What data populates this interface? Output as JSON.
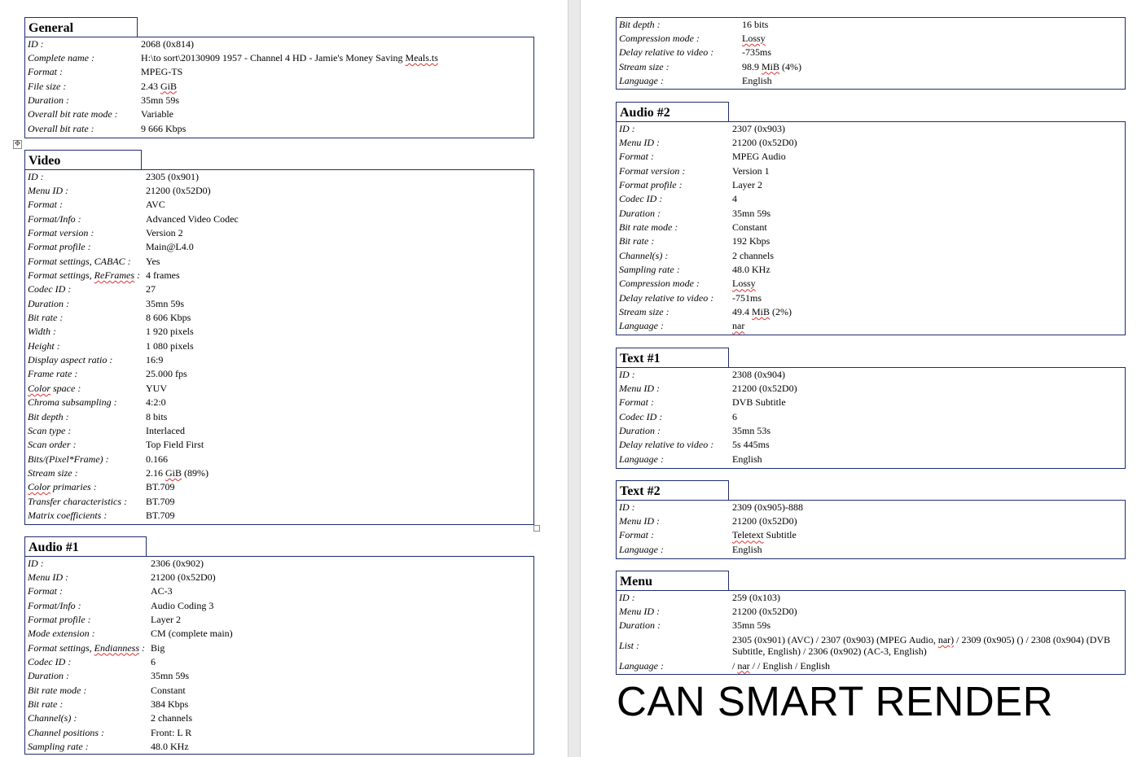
{
  "left_page": {
    "general": {
      "title": "General",
      "rows": [
        {
          "k": "ID :",
          "v": "2068 (0x814)"
        },
        {
          "k": "Complete name :",
          "v": "H:\\to sort\\20130909 1957 - Channel 4 HD - Jamie's Money Saving Meals.ts"
        },
        {
          "k": "Format :",
          "v": "MPEG-TS"
        },
        {
          "k": "File size :",
          "v": "2.43 GiB"
        },
        {
          "k": "Duration :",
          "v": "35mn 59s"
        },
        {
          "k": "Overall bit rate mode :",
          "v": "Variable"
        },
        {
          "k": "Overall bit rate :",
          "v": "9 666 Kbps"
        }
      ]
    },
    "video": {
      "title": "Video",
      "rows": [
        {
          "k": "ID :",
          "v": "2305 (0x901)"
        },
        {
          "k": "Menu ID :",
          "v": "21200 (0x52D0)"
        },
        {
          "k": "Format :",
          "v": "AVC"
        },
        {
          "k": "Format/Info :",
          "v": "Advanced Video Codec"
        },
        {
          "k": "Format version :",
          "v": "Version 2"
        },
        {
          "k": "Format profile :",
          "v": "Main@L4.0"
        },
        {
          "k": "Format settings, CABAC :",
          "v": "Yes"
        },
        {
          "k": "Format settings, ReFrames :",
          "v": "4 frames"
        },
        {
          "k": "Codec ID :",
          "v": "27"
        },
        {
          "k": "Duration :",
          "v": "35mn 59s"
        },
        {
          "k": "Bit rate :",
          "v": "8 606 Kbps"
        },
        {
          "k": "Width :",
          "v": "1 920 pixels"
        },
        {
          "k": "Height :",
          "v": "1 080 pixels"
        },
        {
          "k": "Display aspect ratio :",
          "v": "16:9"
        },
        {
          "k": "Frame rate :",
          "v": "25.000 fps"
        },
        {
          "k": "Color space :",
          "v": "YUV"
        },
        {
          "k": "Chroma subsampling :",
          "v": "4:2:0"
        },
        {
          "k": "Bit depth :",
          "v": "8 bits"
        },
        {
          "k": "Scan type :",
          "v": "Interlaced"
        },
        {
          "k": "Scan order :",
          "v": "Top Field First"
        },
        {
          "k": "Bits/(Pixel*Frame) :",
          "v": "0.166"
        },
        {
          "k": "Stream size :",
          "v": "2.16 GiB (89%)"
        },
        {
          "k": "Color primaries :",
          "v": "BT.709"
        },
        {
          "k": "Transfer characteristics :",
          "v": "BT.709"
        },
        {
          "k": "Matrix coefficients :",
          "v": "BT.709"
        }
      ]
    },
    "audio1": {
      "title": "Audio #1",
      "rows": [
        {
          "k": "ID :",
          "v": "2306 (0x902)"
        },
        {
          "k": "Menu ID :",
          "v": "21200 (0x52D0)"
        },
        {
          "k": "Format :",
          "v": "AC-3"
        },
        {
          "k": "Format/Info :",
          "v": "Audio Coding 3"
        },
        {
          "k": "Format profile :",
          "v": "Layer 2"
        },
        {
          "k": "Mode extension :",
          "v": "CM (complete main)"
        },
        {
          "k": "Format settings, Endianness :",
          "v": "Big"
        },
        {
          "k": "Codec ID :",
          "v": "6"
        },
        {
          "k": "Duration :",
          "v": "35mn 59s"
        },
        {
          "k": "Bit rate mode :",
          "v": "Constant"
        },
        {
          "k": "Bit rate :",
          "v": "384 Kbps"
        },
        {
          "k": "Channel(s) :",
          "v": "2 channels"
        },
        {
          "k": "Channel positions :",
          "v": "Front: L R"
        },
        {
          "k": "Sampling rate :",
          "v": "48.0 KHz"
        }
      ]
    }
  },
  "right_page": {
    "audio1_cont": {
      "rows": [
        {
          "k": "Bit depth :",
          "v": "16 bits"
        },
        {
          "k": "Compression mode :",
          "v": "Lossy"
        },
        {
          "k": "Delay relative to video :",
          "v": "-735ms"
        },
        {
          "k": "Stream size :",
          "v": "98.9 MiB (4%)"
        },
        {
          "k": "Language :",
          "v": "English"
        }
      ]
    },
    "audio2": {
      "title": "Audio #2",
      "rows": [
        {
          "k": "ID :",
          "v": "2307 (0x903)"
        },
        {
          "k": "Menu ID :",
          "v": "21200 (0x52D0)"
        },
        {
          "k": "Format :",
          "v": "MPEG Audio"
        },
        {
          "k": "Format version :",
          "v": "Version 1"
        },
        {
          "k": "Format profile :",
          "v": "Layer 2"
        },
        {
          "k": "Codec ID :",
          "v": "4"
        },
        {
          "k": "Duration :",
          "v": "35mn 59s"
        },
        {
          "k": "Bit rate mode :",
          "v": "Constant"
        },
        {
          "k": "Bit rate :",
          "v": "192 Kbps"
        },
        {
          "k": "Channel(s) :",
          "v": "2 channels"
        },
        {
          "k": "Sampling rate :",
          "v": "48.0 KHz"
        },
        {
          "k": "Compression mode :",
          "v": "Lossy"
        },
        {
          "k": "Delay relative to video :",
          "v": "-751ms"
        },
        {
          "k": "Stream size :",
          "v": "49.4 MiB (2%)"
        },
        {
          "k": "Language :",
          "v": "nar"
        }
      ]
    },
    "text1": {
      "title": "Text #1",
      "rows": [
        {
          "k": "ID :",
          "v": "2308 (0x904)"
        },
        {
          "k": "Menu ID :",
          "v": "21200 (0x52D0)"
        },
        {
          "k": "Format :",
          "v": "DVB Subtitle"
        },
        {
          "k": "Codec ID :",
          "v": "6"
        },
        {
          "k": "Duration :",
          "v": "35mn 53s"
        },
        {
          "k": "Delay relative to video :",
          "v": "5s 445ms"
        },
        {
          "k": "Language :",
          "v": "English"
        }
      ]
    },
    "text2": {
      "title": "Text #2",
      "rows": [
        {
          "k": "ID :",
          "v": "2309 (0x905)-888"
        },
        {
          "k": "Menu ID :",
          "v": "21200 (0x52D0)"
        },
        {
          "k": "Format :",
          "v": "Teletext Subtitle"
        },
        {
          "k": "Language :",
          "v": "English"
        }
      ]
    },
    "menu": {
      "title": "Menu",
      "rows": [
        {
          "k": "ID :",
          "v": "259 (0x103)"
        },
        {
          "k": "Menu ID :",
          "v": "21200 (0x52D0)"
        },
        {
          "k": "Duration :",
          "v": "35mn 59s"
        },
        {
          "k": "List :",
          "v": "2305 (0x901) (AVC) / 2307 (0x903) (MPEG Audio, nar) / 2309 (0x905) () / 2308 (0x904) (DVB Subtitle, English) / 2306 (0x902) (AC-3, English)"
        },
        {
          "k": "Language :",
          "v": "/ nar / / English / English"
        }
      ]
    },
    "note": "CAN SMART RENDER"
  }
}
